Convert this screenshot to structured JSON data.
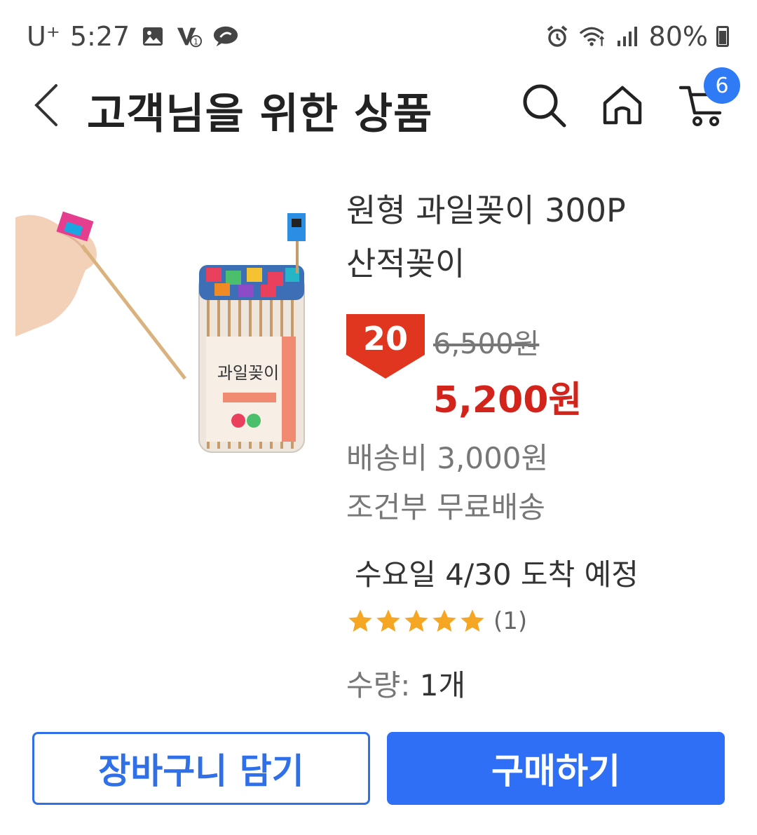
{
  "status_bar": {
    "carrier": "U⁺",
    "time": "5:27",
    "battery": "80%"
  },
  "header": {
    "title": "고객님을 위한 상품",
    "cart_count": "6"
  },
  "product": {
    "name_line1": "원형 과일꽂이 300P",
    "name_line2": "산적꽂이",
    "discount": "20",
    "original_price": "6,500원",
    "sale_price": "5,200원",
    "shipping_fee": "배송비 3,000원",
    "shipping_condition": "조건부 무료배송",
    "arrival": "수요일 4/30 도착 예정",
    "rating": 5,
    "review_count": "(1)",
    "quantity_label": "수량:",
    "quantity_value": "1개",
    "image_label": "과일꽂이"
  },
  "buttons": {
    "add_to_cart": "장바구니 담기",
    "buy": "구매하기"
  },
  "colors": {
    "accent": "#2f6ff5",
    "price_red": "#d3241c",
    "discount_red": "#e0361f",
    "star": "#f5a623"
  }
}
